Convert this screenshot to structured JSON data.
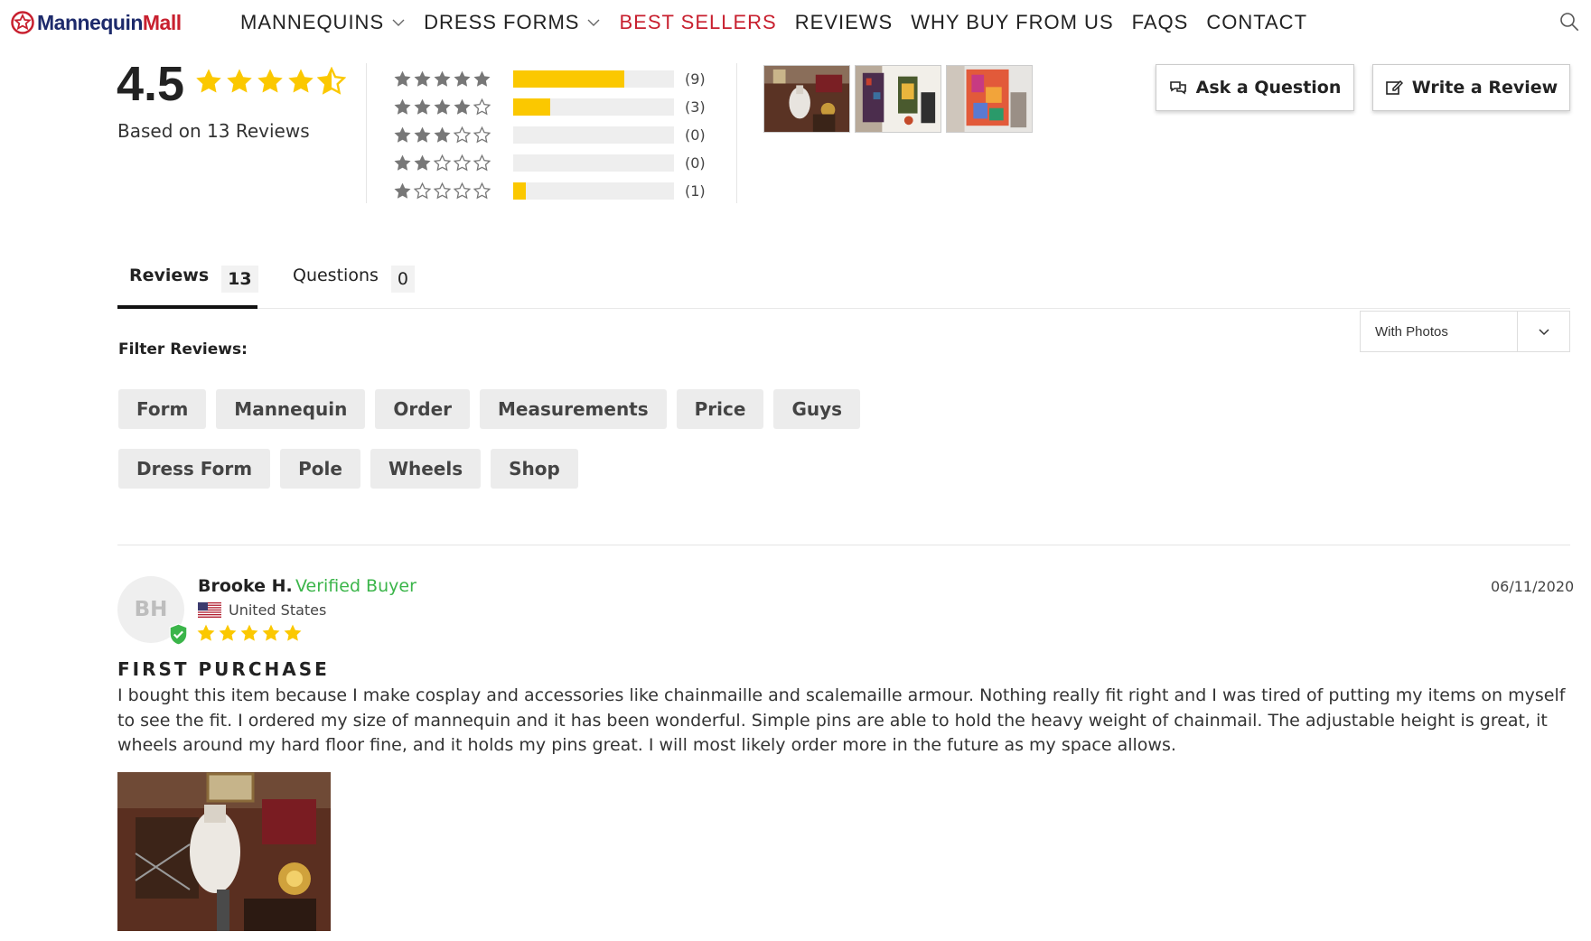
{
  "brand": {
    "name_part1": "Mannequin",
    "name_part2": "Mall"
  },
  "nav": {
    "items": [
      {
        "label": "MANNEQUINS",
        "dropdown": true,
        "active": false
      },
      {
        "label": "DRESS FORMS",
        "dropdown": true,
        "active": false
      },
      {
        "label": "BEST SELLERS",
        "dropdown": false,
        "active": true
      },
      {
        "label": "REVIEWS",
        "dropdown": false,
        "active": false
      },
      {
        "label": "WHY BUY FROM US",
        "dropdown": false,
        "active": false
      },
      {
        "label": "FAQS",
        "dropdown": false,
        "active": false
      },
      {
        "label": "CONTACT",
        "dropdown": false,
        "active": false
      }
    ],
    "search_icon": "search-icon"
  },
  "summary": {
    "average": "4.5",
    "average_value": 4.5,
    "based_on": "Based on 13 Reviews",
    "histogram": [
      {
        "stars": 5,
        "count_label": "(9)",
        "count": 9
      },
      {
        "stars": 4,
        "count_label": "(3)",
        "count": 3
      },
      {
        "stars": 3,
        "count_label": "(0)",
        "count": 0
      },
      {
        "stars": 2,
        "count_label": "(0)",
        "count": 0
      },
      {
        "stars": 1,
        "count_label": "(1)",
        "count": 1
      }
    ],
    "total": 13
  },
  "actions": {
    "ask_label": "Ask a Question",
    "write_label": "Write a Review"
  },
  "tabs": [
    {
      "label": "Reviews",
      "count": "13",
      "active": true
    },
    {
      "label": "Questions",
      "count": "0",
      "active": false
    }
  ],
  "sort_select": {
    "value": "With Photos"
  },
  "filters": {
    "label": "Filter Reviews:",
    "chips": [
      "Form",
      "Mannequin",
      "Order",
      "Measurements",
      "Price",
      "Guys",
      "Dress Form",
      "Pole",
      "Wheels",
      "Shop"
    ]
  },
  "review": {
    "initials": "BH",
    "author": "Brooke H.",
    "verified": "Verified Buyer",
    "country": "United States",
    "rating": 5,
    "date": "06/11/2020",
    "title": "FIRST PURCHASE",
    "body": "I bought this item because I make cosplay and accessories like chainmaille and scalemaille armour. Nothing really fit right and I was tired of putting my items on myself to see the fit. I ordered my size of mannequin and it has been wonderful. Simple pins are able to hold the heavy weight of chainmail. The adjustable height is great, it wheels around my hard floor fine, and it holds my pins great. I will most likely order more in the future as my space allows."
  },
  "colors": {
    "brand_navy": "#1d2a6b",
    "brand_red": "#c8202f",
    "star_gold": "#fbc800",
    "verified_green": "#3bb54a",
    "empty_star": "#777777"
  }
}
